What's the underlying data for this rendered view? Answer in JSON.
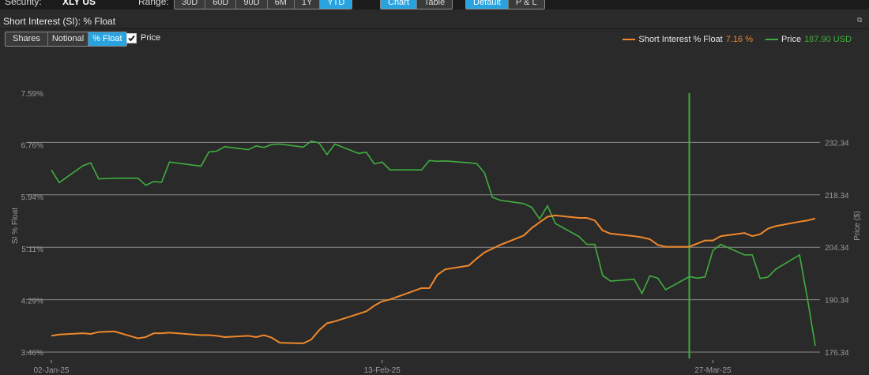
{
  "topbar": {
    "security_label": "Security:",
    "security_value": "XLY US",
    "range_label": "Range:",
    "range_options": [
      "30D",
      "60D",
      "90D",
      "6M",
      "1Y",
      "YTD"
    ],
    "range_active": "YTD",
    "view_options": [
      "Chart",
      "Table"
    ],
    "view_active": "Chart",
    "mode_options": [
      "Default",
      "P & L"
    ],
    "mode_active": "Default"
  },
  "panel": {
    "title": "Short Interest (SI): % Float",
    "measure_options": [
      "Shares",
      "Notional",
      "% Float"
    ],
    "measure_active": "% Float",
    "price_checkbox_label": "Price",
    "price_checked": true
  },
  "legend": {
    "si_label": "Short Interest % Float",
    "si_value": "7.16 %",
    "price_label": "Price",
    "price_value": "187.90 USD"
  },
  "colors": {
    "background": "#2a2a2a",
    "si_line": "#f0882b",
    "price_line": "#3fae3f",
    "active_tab": "#29a3e0",
    "gridline": "#8a8a8a"
  },
  "chart_data": {
    "type": "line",
    "title": "",
    "ylabel": "SI % Float",
    "y2label": "Price ($)",
    "ylim": [
      3.46,
      7.59
    ],
    "y2lim": [
      176.34,
      246.34
    ],
    "yticks": [
      "7.59%",
      "6.76%",
      "5.94%",
      "5.11%",
      "4.29%",
      "3.46%"
    ],
    "y2ticks": [
      "232.34",
      "218.34",
      "204.34",
      "190.34",
      "176.34"
    ],
    "x_dates": [
      "02-Jan-25",
      "13-Feb-25",
      "27-Mar-25"
    ],
    "cursor_date": "2025-03-24",
    "series": [
      {
        "name": "Short Interest % Float",
        "x": [
          "2025-01-02",
          "2025-01-03",
          "2025-01-06",
          "2025-01-07",
          "2025-01-08",
          "2025-01-10",
          "2025-01-13",
          "2025-01-14",
          "2025-01-15",
          "2025-01-16",
          "2025-01-17",
          "2025-01-21",
          "2025-01-22",
          "2025-01-23",
          "2025-01-24",
          "2025-01-27",
          "2025-01-28",
          "2025-01-29",
          "2025-01-30",
          "2025-01-31",
          "2025-02-03",
          "2025-02-04",
          "2025-02-05",
          "2025-02-06",
          "2025-02-07",
          "2025-02-10",
          "2025-02-11",
          "2025-02-12",
          "2025-02-13",
          "2025-02-14",
          "2025-02-18",
          "2025-02-19",
          "2025-02-20",
          "2025-02-21",
          "2025-02-24",
          "2025-02-25",
          "2025-02-26",
          "2025-02-27",
          "2025-02-28",
          "2025-03-03",
          "2025-03-04",
          "2025-03-05",
          "2025-03-06",
          "2025-03-07",
          "2025-03-10",
          "2025-03-11",
          "2025-03-12",
          "2025-03-13",
          "2025-03-14",
          "2025-03-17",
          "2025-03-18",
          "2025-03-19",
          "2025-03-20",
          "2025-03-21",
          "2025-03-24",
          "2025-03-25",
          "2025-03-26",
          "2025-03-27",
          "2025-03-28",
          "2025-03-31",
          "2025-04-01",
          "2025-04-02",
          "2025-04-03",
          "2025-04-04",
          "2025-04-07",
          "2025-04-08",
          "2025-04-09"
        ],
        "values": [
          3.72,
          3.74,
          3.76,
          3.75,
          3.78,
          3.79,
          3.68,
          3.7,
          3.76,
          3.76,
          3.77,
          3.73,
          3.73,
          3.72,
          3.7,
          3.72,
          3.7,
          3.73,
          3.69,
          3.61,
          3.6,
          3.66,
          3.81,
          3.92,
          3.95,
          4.07,
          4.11,
          4.2,
          4.27,
          4.3,
          4.48,
          4.48,
          4.69,
          4.78,
          4.84,
          4.95,
          5.05,
          5.11,
          5.17,
          5.32,
          5.44,
          5.53,
          5.62,
          5.64,
          5.6,
          5.6,
          5.56,
          5.4,
          5.35,
          5.31,
          5.29,
          5.26,
          5.17,
          5.14,
          5.14,
          5.19,
          5.24,
          5.24,
          5.31,
          5.36,
          5.31,
          5.34,
          5.43,
          5.47,
          5.54,
          5.56,
          5.59
        ]
      },
      {
        "name": "Price",
        "x": [
          "2025-01-02",
          "2025-01-03",
          "2025-01-06",
          "2025-01-07",
          "2025-01-08",
          "2025-01-10",
          "2025-01-13",
          "2025-01-14",
          "2025-01-15",
          "2025-01-16",
          "2025-01-17",
          "2025-01-21",
          "2025-01-22",
          "2025-01-23",
          "2025-01-24",
          "2025-01-27",
          "2025-01-28",
          "2025-01-29",
          "2025-01-30",
          "2025-01-31",
          "2025-02-03",
          "2025-02-04",
          "2025-02-05",
          "2025-02-06",
          "2025-02-07",
          "2025-02-10",
          "2025-02-11",
          "2025-02-12",
          "2025-02-13",
          "2025-02-14",
          "2025-02-18",
          "2025-02-19",
          "2025-02-20",
          "2025-02-21",
          "2025-02-24",
          "2025-02-25",
          "2025-02-26",
          "2025-02-27",
          "2025-02-28",
          "2025-03-03",
          "2025-03-04",
          "2025-03-05",
          "2025-03-06",
          "2025-03-07",
          "2025-03-10",
          "2025-03-11",
          "2025-03-12",
          "2025-03-13",
          "2025-03-14",
          "2025-03-17",
          "2025-03-18",
          "2025-03-19",
          "2025-03-20",
          "2025-03-21",
          "2025-03-24",
          "2025-03-25",
          "2025-03-26",
          "2025-03-27",
          "2025-03-28",
          "2025-03-31",
          "2025-04-01",
          "2025-04-02",
          "2025-04-03",
          "2025-04-04",
          "2025-04-07",
          "2025-04-08",
          "2025-04-09"
        ],
        "values": [
          225.0,
          221.6,
          226.1,
          226.9,
          222.6,
          222.8,
          222.8,
          220.9,
          221.9,
          221.7,
          227.1,
          226.0,
          229.8,
          230.0,
          231.2,
          230.4,
          231.4,
          231.0,
          231.8,
          231.9,
          231.1,
          232.7,
          232.2,
          229.1,
          231.9,
          229.4,
          229.7,
          226.6,
          227.1,
          225.0,
          225.0,
          227.5,
          227.3,
          227.4,
          226.9,
          226.7,
          224.2,
          217.7,
          216.9,
          216.0,
          215.0,
          211.9,
          215.4,
          210.7,
          207.2,
          205.1,
          205.1,
          196.8,
          195.3,
          195.8,
          192.0,
          196.7,
          196.1,
          193.0,
          196.5,
          196.1,
          196.4,
          203.5,
          205.1,
          202.3,
          202.3,
          196.0,
          196.4,
          198.5,
          202.3,
          190.7,
          178.0
        ]
      }
    ]
  }
}
